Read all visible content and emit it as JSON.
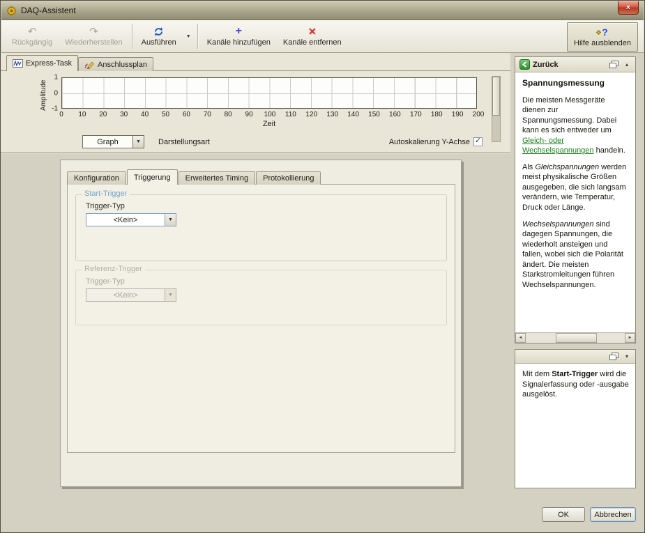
{
  "window": {
    "title": "DAQ-Assistent"
  },
  "toolbar": {
    "undo": "Rückgängig",
    "redo": "Wiederherstellen",
    "run": "Ausführen",
    "add_channels": "Kanäle hinzufügen",
    "remove_channels": "Kanäle entfernen",
    "hide_help": "Hilfe ausblenden"
  },
  "task_tabs": {
    "express": "Express-Task",
    "wiring": "Anschlussplan"
  },
  "graph": {
    "y_label": "Amplitude",
    "x_label": "Zeit",
    "y_ticks": [
      "1",
      "0",
      "-1"
    ],
    "x_ticks": [
      "0",
      "10",
      "20",
      "30",
      "40",
      "50",
      "60",
      "70",
      "80",
      "90",
      "100",
      "110",
      "120",
      "130",
      "140",
      "150",
      "160",
      "170",
      "180",
      "190",
      "200"
    ],
    "display_type_value": "Graph",
    "display_type_label": "Darstellungsart",
    "autoscale_label": "Autoskalierung Y-Achse",
    "autoscale_checked": true
  },
  "dialog": {
    "tabs": [
      {
        "label": "Konfiguration"
      },
      {
        "label": "Triggerung"
      },
      {
        "label": "Erweitertes Timing"
      },
      {
        "label": "Protokollierung"
      }
    ],
    "start_trigger": {
      "title": "Start-Trigger",
      "type_label": "Trigger-Typ",
      "type_value": "<Kein>"
    },
    "reference_trigger": {
      "title": "Referenz-Trigger",
      "type_label": "Trigger-Typ",
      "type_value": "<Kein>"
    }
  },
  "help": {
    "back": "Zurück",
    "title": "Spannungsmessung",
    "para1": [
      {
        "t": "Die meisten Messgeräte dienen zur Spannungsmessung. Dabei kann es sich entweder um "
      },
      {
        "t": "Gleich- oder Wechselspannungen"
      },
      {
        "t": " handeln."
      }
    ],
    "para2": [
      {
        "t": "Als "
      },
      {
        "t": "Gleichspannungen"
      },
      {
        "t": " werden meist physikalische Größen ausgegeben, die sich langsam verändern, wie Temperatur, Druck oder Länge."
      }
    ],
    "para3": [
      {
        "t": "Wechselspannungen"
      },
      {
        "t": " sind dagegen Spannungen, die wiederholt ansteigen und fallen, wobei sich die Polarität ändert. Die meisten Starkstromleitungen führen Wechselspannungen."
      }
    ],
    "tip": [
      {
        "t": "Mit dem "
      },
      {
        "t": "Start-Trigger"
      },
      {
        "t": " wird die Signalerfassung oder -ausgabe ausgelöst."
      }
    ]
  },
  "footer": {
    "ok": "OK",
    "cancel": "Abbrechen"
  },
  "colors": {
    "link_green": "#1e7d1e",
    "group_label_blue": "#6fa3cc",
    "run_icon_blue": "#1f55cc",
    "add_icon_blue": "#4343cf",
    "remove_icon_red": "#cf2e2e",
    "close_button_red": "#b13a24",
    "titlebar_olive": "#a8a58c"
  }
}
